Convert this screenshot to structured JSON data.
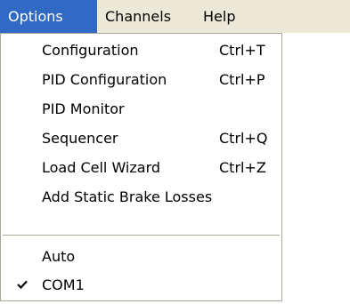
{
  "menubar": {
    "items": [
      {
        "label": "Options"
      },
      {
        "label": "Channels"
      },
      {
        "label": "Help"
      }
    ]
  },
  "menu": {
    "items": [
      {
        "label": "Configuration",
        "shortcut": "Ctrl+T"
      },
      {
        "label": "PID Configuration",
        "shortcut": "Ctrl+P"
      },
      {
        "label": "PID Monitor",
        "shortcut": ""
      },
      {
        "label": "Sequencer",
        "shortcut": "Ctrl+Q"
      },
      {
        "label": "Load Cell Wizard",
        "shortcut": "Ctrl+Z"
      },
      {
        "label": "Add Static Brake Losses",
        "shortcut": ""
      },
      {
        "label": "Auto",
        "checked": false
      },
      {
        "label": "COM1",
        "checked": true,
        "icon": "checkmark-icon"
      }
    ]
  },
  "colors": {
    "menubar_bg": "#ece9d8",
    "highlight": "#316ac5",
    "menu_bg": "#ffffff",
    "border": "#aca899"
  }
}
